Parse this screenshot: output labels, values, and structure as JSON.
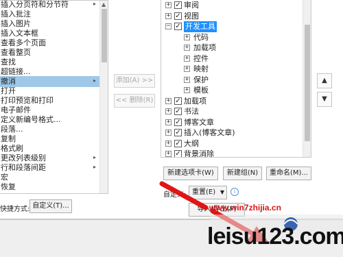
{
  "left_list": {
    "items": [
      {
        "label": "插入分页符和分节符",
        "has_submenu": true
      },
      {
        "label": "插入批注"
      },
      {
        "label": "插入图片"
      },
      {
        "label": "插入文本框"
      },
      {
        "label": "查看多个页面"
      },
      {
        "label": "查看整页"
      },
      {
        "label": "查找"
      },
      {
        "label": "超链接..."
      },
      {
        "label": "撤消",
        "has_submenu": true,
        "selected": true
      },
      {
        "label": "打开"
      },
      {
        "label": "打印预览和打印"
      },
      {
        "label": "电子邮件"
      },
      {
        "label": "定义新编号格式..."
      },
      {
        "label": "段落..."
      },
      {
        "label": "复制"
      },
      {
        "label": "格式刷"
      },
      {
        "label": "更改列表级别",
        "has_submenu": true
      },
      {
        "label": "行和段落间距",
        "has_submenu": true
      },
      {
        "label": "宏"
      },
      {
        "label": "恢复"
      }
    ]
  },
  "middle": {
    "add_label": "添加(A) >>",
    "remove_label": "<< 删除(R)"
  },
  "tree": {
    "rows": [
      {
        "label": "审阅",
        "level": 0,
        "expander": "+",
        "checked": true
      },
      {
        "label": "视图",
        "level": 0,
        "expander": "+",
        "checked": true
      },
      {
        "label": "开发工具",
        "level": 0,
        "expander": "−",
        "checked": true,
        "selected": true
      },
      {
        "label": "代码",
        "level": 1,
        "expander": "+"
      },
      {
        "label": "加载项",
        "level": 1,
        "expander": "+"
      },
      {
        "label": "控件",
        "level": 1,
        "expander": "+"
      },
      {
        "label": "映射",
        "level": 1,
        "expander": "+"
      },
      {
        "label": "保护",
        "level": 1,
        "expander": "+"
      },
      {
        "label": "模板",
        "level": 1,
        "expander": "+"
      },
      {
        "label": "加载项",
        "level": 0,
        "expander": "+",
        "checked": true
      },
      {
        "label": "书法",
        "level": 0,
        "expander": "+",
        "checked": true
      },
      {
        "label": "博客文章",
        "level": 0,
        "expander": "+",
        "checked": true
      },
      {
        "label": "插入(博客文章)",
        "level": 0,
        "expander": "+",
        "checked": true
      },
      {
        "label": "大纲",
        "level": 0,
        "expander": "+",
        "checked": true
      },
      {
        "label": "背景消除",
        "level": 0,
        "expander": "+",
        "checked": true
      }
    ]
  },
  "move_buttons": {
    "up": "▲",
    "down": "▼"
  },
  "buttons": {
    "new_tab": "新建选项卡(W)",
    "new_group": "新建组(N)",
    "rename": "重命名(M)...",
    "customize": "自定义(T)...",
    "import_export": "导入/导出(P)"
  },
  "labels": {
    "shortcut": "快捷方式:",
    "customization": "自定义:"
  },
  "dropdown": {
    "value": "重置(E)"
  },
  "watermark": {
    "url": "www.win7zhijia.cn",
    "logo_text": "leisu123.com"
  },
  "colors": {
    "selection": "#1e90ff",
    "arrow": "#e01515"
  }
}
